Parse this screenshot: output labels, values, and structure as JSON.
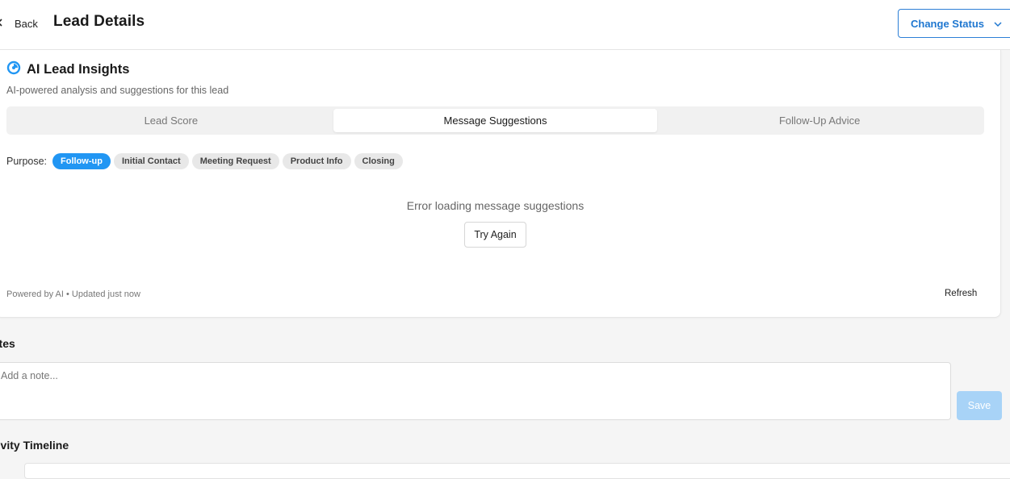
{
  "header": {
    "back_label": "Back",
    "title": "Lead Details",
    "change_status_label": "Change Status"
  },
  "insights": {
    "title": "AI Lead Insights",
    "subtitle": "AI-powered analysis and suggestions for this lead",
    "tabs": [
      {
        "label": "Lead Score",
        "active": false
      },
      {
        "label": "Message Suggestions",
        "active": true
      },
      {
        "label": "Follow-Up Advice",
        "active": false
      }
    ],
    "purpose": {
      "label": "Purpose:",
      "options": [
        {
          "label": "Follow-up",
          "active": true
        },
        {
          "label": "Initial Contact",
          "active": false
        },
        {
          "label": "Meeting Request",
          "active": false
        },
        {
          "label": "Product Info",
          "active": false
        },
        {
          "label": "Closing",
          "active": false
        }
      ]
    },
    "error_message": "Error loading message suggestions",
    "try_again_label": "Try Again",
    "footer_text": "Powered by AI • Updated just now",
    "refresh_label": "Refresh"
  },
  "notes": {
    "title": "otes",
    "placeholder": "Add a note...",
    "value": "",
    "save_label": "Save"
  },
  "timeline": {
    "title": "tivity Timeline"
  },
  "colors": {
    "accent": "#2196f3",
    "save_disabled": "#a8d3f7"
  }
}
